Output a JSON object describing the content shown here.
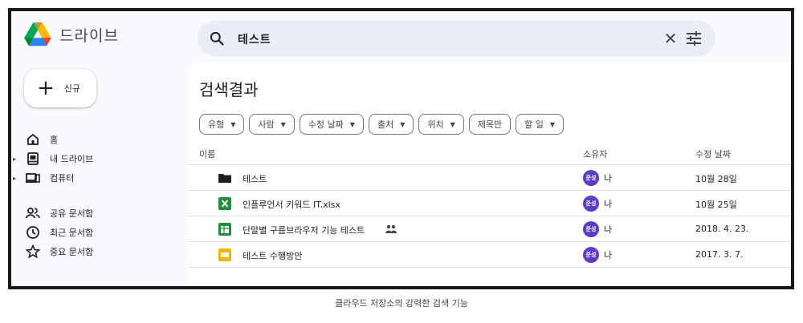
{
  "app": {
    "brand": "드라이브"
  },
  "search": {
    "query": "테스트",
    "clear_label": "✕"
  },
  "sidebar": {
    "new_label": "신규",
    "items": [
      {
        "label": "홈",
        "icon": "home-icon"
      },
      {
        "label": "내 드라이브",
        "icon": "drive-icon"
      },
      {
        "label": "컴퓨터",
        "icon": "computer-icon"
      },
      {
        "label": "공유 문서함",
        "icon": "shared-icon"
      },
      {
        "label": "최근 문서함",
        "icon": "clock-icon"
      },
      {
        "label": "중요 문서함",
        "icon": "star-icon"
      }
    ]
  },
  "main": {
    "title": "검색결과",
    "chips": [
      "유형",
      "사람",
      "수정 날짜",
      "출처",
      "위치",
      "제목만",
      "할 일"
    ],
    "columns": {
      "name": "이름",
      "owner": "소유자",
      "modified": "수정 날짜"
    },
    "rows": [
      {
        "name": "테스트",
        "type": "folder",
        "owner": "나",
        "avatar_text": "준성",
        "modified": "10월 28일"
      },
      {
        "name": "인플루언서 키워드 IT.xlsx",
        "type": "excel",
        "owner": "나",
        "avatar_text": "준성",
        "modified": "10월 25일"
      },
      {
        "name": "단말별 구름브라우저 기능 테스트",
        "type": "sheets",
        "owner": "나",
        "avatar_text": "준성",
        "modified": "2018. 4. 23.",
        "shared": true
      },
      {
        "name": "테스트 수행방안",
        "type": "slides",
        "owner": "나",
        "avatar_text": "준성",
        "modified": "2017. 3. 7."
      }
    ]
  },
  "caption": "클라우드 저장소의 강력한 검색 기능",
  "colors": {
    "accent": "#0b57d0",
    "avatar": "#5b3cc4",
    "search_bg": "#e9eef6"
  }
}
